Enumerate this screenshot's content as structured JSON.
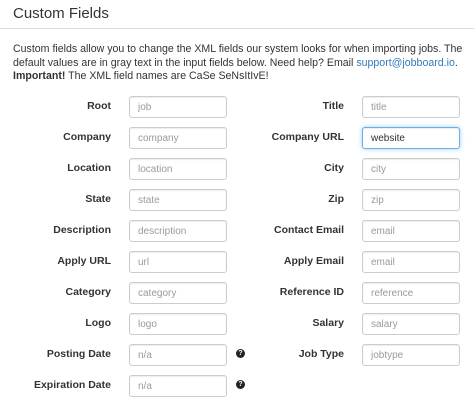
{
  "panel": {
    "title": "Custom Fields"
  },
  "intro": {
    "text_1": "Custom fields allow you to change the XML fields our system looks for when importing jobs. The default values are in gray text in the input fields below. Need help? Email ",
    "email": "support@jobboard.io",
    "text_2": ". ",
    "important": "Important!",
    "text_3": " The XML field names are CaSe SeNsItIvE!"
  },
  "fields": {
    "root": {
      "label": "Root",
      "placeholder": "job",
      "value": ""
    },
    "title": {
      "label": "Title",
      "placeholder": "title",
      "value": ""
    },
    "company": {
      "label": "Company",
      "placeholder": "company",
      "value": ""
    },
    "company_url": {
      "label": "Company URL",
      "placeholder": "website",
      "value": "website"
    },
    "location": {
      "label": "Location",
      "placeholder": "location",
      "value": ""
    },
    "city": {
      "label": "City",
      "placeholder": "city",
      "value": ""
    },
    "state": {
      "label": "State",
      "placeholder": "state",
      "value": ""
    },
    "zip": {
      "label": "Zip",
      "placeholder": "zip",
      "value": ""
    },
    "description": {
      "label": "Description",
      "placeholder": "description",
      "value": ""
    },
    "contact_email": {
      "label": "Contact Email",
      "placeholder": "email",
      "value": ""
    },
    "apply_url": {
      "label": "Apply URL",
      "placeholder": "url",
      "value": ""
    },
    "apply_email": {
      "label": "Apply Email",
      "placeholder": "email",
      "value": ""
    },
    "category": {
      "label": "Category",
      "placeholder": "category",
      "value": ""
    },
    "reference_id": {
      "label": "Reference ID",
      "placeholder": "reference",
      "value": ""
    },
    "logo": {
      "label": "Logo",
      "placeholder": "logo",
      "value": ""
    },
    "salary": {
      "label": "Salary",
      "placeholder": "salary",
      "value": ""
    },
    "posting_date": {
      "label": "Posting Date",
      "placeholder": "n/a",
      "value": ""
    },
    "job_type": {
      "label": "Job Type",
      "placeholder": "jobtype",
      "value": ""
    },
    "expiration_date": {
      "label": "Expiration Date",
      "placeholder": "n/a",
      "value": ""
    }
  },
  "help_icon_glyph": "?"
}
